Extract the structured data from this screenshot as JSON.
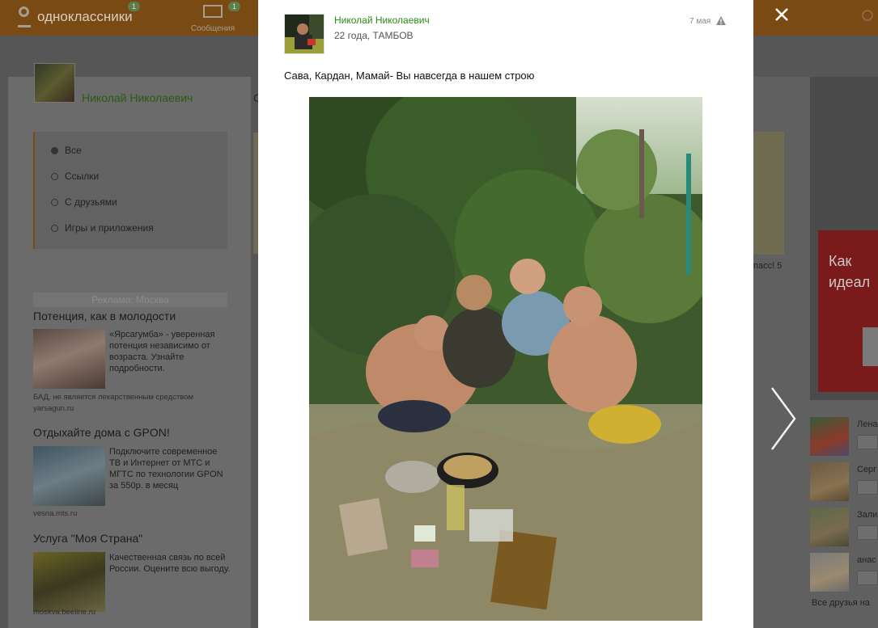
{
  "topbar": {
    "logo_text": "одноклассники",
    "logo_badge": "1",
    "messages_label": "Сообщения",
    "messages_badge": "1"
  },
  "profile": {
    "name": "Николай Николаевич",
    "feed_heading_fragment": "С"
  },
  "feed_filter": {
    "items": [
      {
        "label": "Все",
        "selected": true
      },
      {
        "label": "Ссылки",
        "selected": false
      },
      {
        "label": "С друзьями",
        "selected": false
      },
      {
        "label": "Игры и приложения",
        "selected": false
      }
    ]
  },
  "ads": {
    "header": "Реклама: Москва",
    "items": [
      {
        "title": "Потенция, как в молодости",
        "text": "«Ярсагумба» - уверенная потенция независимо от возраста. Узнайте подробности.",
        "disclaimer": "БАД, не является лекарственным средством",
        "source": "yarsagun.ru"
      },
      {
        "title": "Отдыхайте дома с GPON!",
        "text": "Подключите современное ТВ и Интернет от МТС и МГТС по технологии GPON за 550р. в месяц",
        "source": "vesna.mts.ru"
      },
      {
        "title": "Услуга \"Моя Страна\"",
        "text": "Качественная связь по всей России. Оцените всю выгоду.",
        "source": "moskva.beeline.ru"
      }
    ]
  },
  "right_column": {
    "fragment": "пасс! 5",
    "promo_text": "Как\nидеал",
    "friends": [
      {
        "name": "Лена"
      },
      {
        "name": "Серг"
      },
      {
        "name": "Зали"
      },
      {
        "name": "анас"
      }
    ],
    "all_friends": "Все друзья на"
  },
  "post": {
    "author": "Николай Николаевич",
    "meta": "22 года, ТАМБОВ",
    "date": "7 мая",
    "text": "Сава, Кардан, Мамай- Вы навсегда в нашем строю"
  },
  "icons": {
    "close": "close-icon",
    "next": "chevron-right-icon",
    "warning": "warning-icon",
    "envelope": "envelope-icon"
  },
  "colors": {
    "brand_orange": "#ee8208",
    "author_green": "#2a8a12",
    "overlay": "#565656"
  }
}
